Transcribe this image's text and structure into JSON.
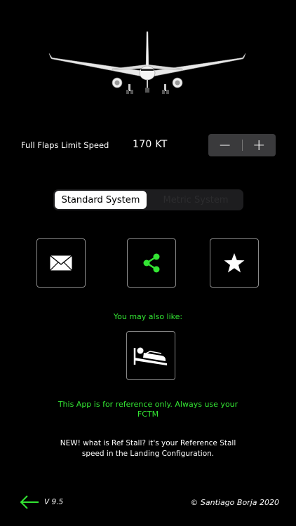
{
  "speed": {
    "label": "Full Flaps Limit Speed",
    "value": "170 KT",
    "decrement_symbol": "−",
    "increment_symbol": "+"
  },
  "unit_system": {
    "options": [
      "Standard System",
      "Metric System"
    ],
    "selected": "Standard System"
  },
  "actions": [
    {
      "name": "mail",
      "icon": "envelope-icon"
    },
    {
      "name": "share",
      "icon": "share-icon",
      "color": "#33e533"
    },
    {
      "name": "rate",
      "icon": "star-icon"
    }
  ],
  "promo": {
    "heading": "You may also like:",
    "app_icon": "sleeping-person-icon"
  },
  "disclaimer": "This App is for reference only. Always use your FCTM",
  "news": "NEW! what is Ref Stall? it's your Reference Stall speed in the Landing Configuration.",
  "footer": {
    "back_icon": "arrow-left-icon",
    "version": "V 9.5",
    "copyright": "© Santiago Borja 2020"
  },
  "colors": {
    "accent_green": "#33e533",
    "background": "#000000",
    "stepper_bg": "#3a3a3c"
  }
}
